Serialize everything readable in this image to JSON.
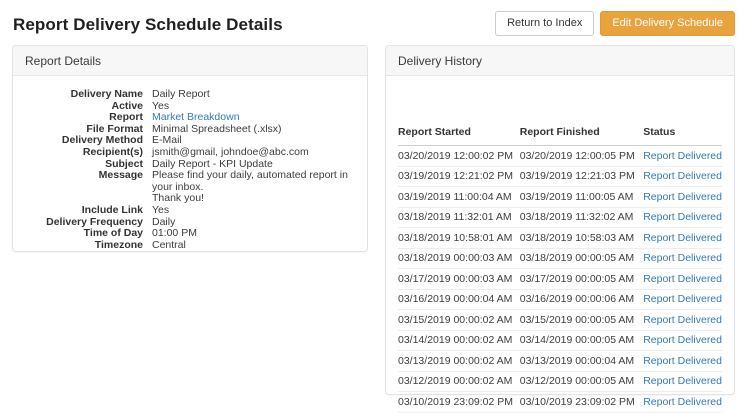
{
  "page": {
    "title": "Report Delivery Schedule Details"
  },
  "toolbar": {
    "return_to_index_label": "Return to Index",
    "edit_delivery_schedule_label": "Edit Delivery Schedule"
  },
  "colors": {
    "accent_orange": "#e8a33d",
    "link_blue": "#337ab7",
    "panel_heading_bg": "#f7f7f7"
  },
  "report_details": {
    "title": "Report Details",
    "fields": [
      {
        "label": "Delivery Name",
        "value": "Daily Report",
        "link": false
      },
      {
        "label": "Active",
        "value": "Yes",
        "link": false
      },
      {
        "label": "Report",
        "value": "Market Breakdown",
        "link": true
      },
      {
        "label": "File Format",
        "value": "Minimal Spreadsheet (.xlsx)",
        "link": false
      },
      {
        "label": "Delivery Method",
        "value": "E-Mail",
        "link": false
      },
      {
        "label": "Recipient(s)",
        "value": "jsmith@gmail, johndoe@abc.com",
        "link": false
      },
      {
        "label": "Subject",
        "value": "Daily Report - KPI Update",
        "link": false
      },
      {
        "label": "Message",
        "value": "Please find your daily, automated report in your inbox.\nThank you!",
        "link": false
      },
      {
        "label": "Include Link",
        "value": "Yes",
        "link": false
      },
      {
        "label": "Delivery Frequency",
        "value": "Daily",
        "link": false
      },
      {
        "label": "Time of Day",
        "value": "01:00 PM",
        "link": false
      },
      {
        "label": "Timezone",
        "value": "Central",
        "link": false
      }
    ]
  },
  "delivery_history": {
    "title": "Delivery History",
    "columns": [
      "Report Started",
      "Report Finished",
      "Status"
    ],
    "rows": [
      {
        "started": "03/20/2019 12:00:02 PM",
        "finished": "03/20/2019 12:00:05 PM",
        "status": "Report Delivered"
      },
      {
        "started": "03/19/2019 12:21:02 PM",
        "finished": "03/19/2019 12:21:03 PM",
        "status": "Report Delivered"
      },
      {
        "started": "03/19/2019 11:00:04 AM",
        "finished": "03/19/2019 11:00:05 AM",
        "status": "Report Delivered"
      },
      {
        "started": "03/18/2019 11:32:01 AM",
        "finished": "03/18/2019 11:32:02 AM",
        "status": "Report Delivered"
      },
      {
        "started": "03/18/2019 10:58:01 AM",
        "finished": "03/18/2019 10:58:03 AM",
        "status": "Report Delivered"
      },
      {
        "started": "03/18/2019 00:00:03 AM",
        "finished": "03/18/2019 00:00:05 AM",
        "status": "Report Delivered"
      },
      {
        "started": "03/17/2019 00:00:03 AM",
        "finished": "03/17/2019 00:00:05 AM",
        "status": "Report Delivered"
      },
      {
        "started": "03/16/2019 00:00:04 AM",
        "finished": "03/16/2019 00:00:06 AM",
        "status": "Report Delivered"
      },
      {
        "started": "03/15/2019 00:00:02 AM",
        "finished": "03/15/2019 00:00:05 AM",
        "status": "Report Delivered"
      },
      {
        "started": "03/14/2019 00:00:02 AM",
        "finished": "03/14/2019 00:00:05 AM",
        "status": "Report Delivered"
      },
      {
        "started": "03/13/2019 00:00:02 AM",
        "finished": "03/13/2019 00:00:04 AM",
        "status": "Report Delivered"
      },
      {
        "started": "03/12/2019 00:00:02 AM",
        "finished": "03/12/2019 00:00:05 AM",
        "status": "Report Delivered"
      },
      {
        "started": "03/10/2019 23:09:02 PM",
        "finished": "03/10/2019 23:09:02 PM",
        "status": "Report Delivered"
      }
    ]
  }
}
